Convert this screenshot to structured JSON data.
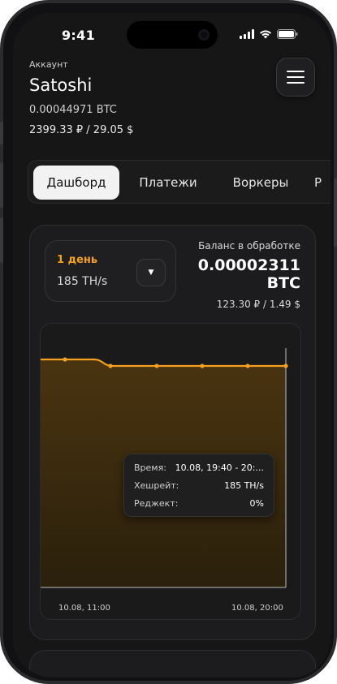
{
  "status_bar": {
    "time": "9:41"
  },
  "account": {
    "label": "Аккаунт",
    "name": "Satoshi",
    "btc_balance": "0.00044971 BTC",
    "fiat_balance": "2399.33 ₽ / 29.05 $"
  },
  "menu": {
    "icon": "hamburger-icon"
  },
  "tabs": [
    {
      "label": "Дашборд",
      "active": true
    },
    {
      "label": "Платежи",
      "active": false
    },
    {
      "label": "Воркеры",
      "active": false
    },
    {
      "label": "Р",
      "active": false
    }
  ],
  "dashboard": {
    "period": {
      "label": "1 день",
      "hashrate": "185 TH/s",
      "dropdown_icon": "▼"
    },
    "processing_balance": {
      "label": "Баланс в обработке",
      "value": "0.00002311 BTC",
      "fiat": "123.30 ₽ / 1.49 $"
    },
    "chart_data": {
      "type": "area",
      "x": [
        "10.08, 11:00",
        "",
        "",
        "",
        "",
        "10.08, 20:00"
      ],
      "x_tick_labels": [
        "10.08, 11:00",
        "10.08, 20:00"
      ],
      "series": [
        {
          "values": [
            190,
            190,
            185,
            185,
            185,
            185,
            185
          ]
        }
      ],
      "colors": {
        "line": "#f4a020",
        "fill": "#3a2a0c"
      }
    },
    "tooltip": {
      "time_label": "Время:",
      "time_value": "10.08, 19:40 - 20:...",
      "hashrate_label": "Хешрейт:",
      "hashrate_value": "185 TH/s",
      "reject_label": "Реджект:",
      "reject_value": "0%"
    }
  }
}
